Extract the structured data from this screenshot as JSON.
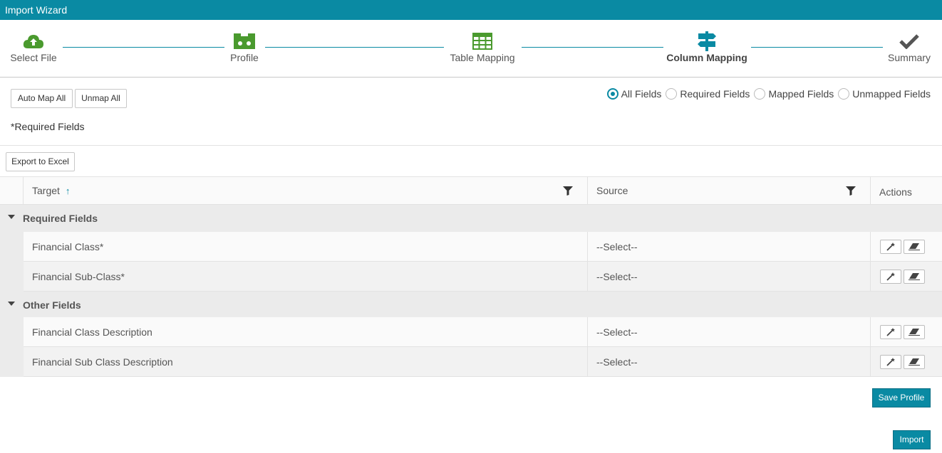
{
  "window": {
    "title": "Import Wizard"
  },
  "steps": [
    {
      "label": "Select File",
      "icon": "cloud-upload-icon",
      "color": "#4a9a2e"
    },
    {
      "label": "Profile",
      "icon": "profile-icon",
      "color": "#4a9a2e"
    },
    {
      "label": "Table Mapping",
      "icon": "table-icon",
      "color": "#4a9a2e"
    },
    {
      "label": "Column Mapping",
      "icon": "signpost-icon",
      "color": "#0a8aa3",
      "active": true
    },
    {
      "label": "Summary",
      "icon": "checkmark-icon",
      "color": "#555555"
    }
  ],
  "mapping_buttons": {
    "auto_map_all": "Auto Map All",
    "unmap_all": "Unmap All"
  },
  "filter_options": {
    "selected": "All Fields",
    "options": [
      "All Fields",
      "Required Fields",
      "Mapped Fields",
      "Unmapped Fields"
    ]
  },
  "required_note": "*Required Fields",
  "grid": {
    "export_label": "Export to Excel",
    "columns": {
      "target": "Target",
      "source": "Source",
      "actions": "Actions"
    },
    "groups": [
      {
        "label": "Required Fields",
        "rows": [
          {
            "target": "Financial Class*",
            "source": "--Select--"
          },
          {
            "target": "Financial Sub-Class*",
            "source": "--Select--"
          }
        ]
      },
      {
        "label": "Other Fields",
        "rows": [
          {
            "target": "Financial Class Description",
            "source": "--Select--"
          },
          {
            "target": "Financial Sub Class Description",
            "source": "--Select--"
          }
        ]
      }
    ]
  },
  "footer": {
    "save_profile": "Save Profile",
    "import": "Import"
  },
  "colors": {
    "accent": "#0a8aa3",
    "step_done": "#4a9a2e"
  }
}
